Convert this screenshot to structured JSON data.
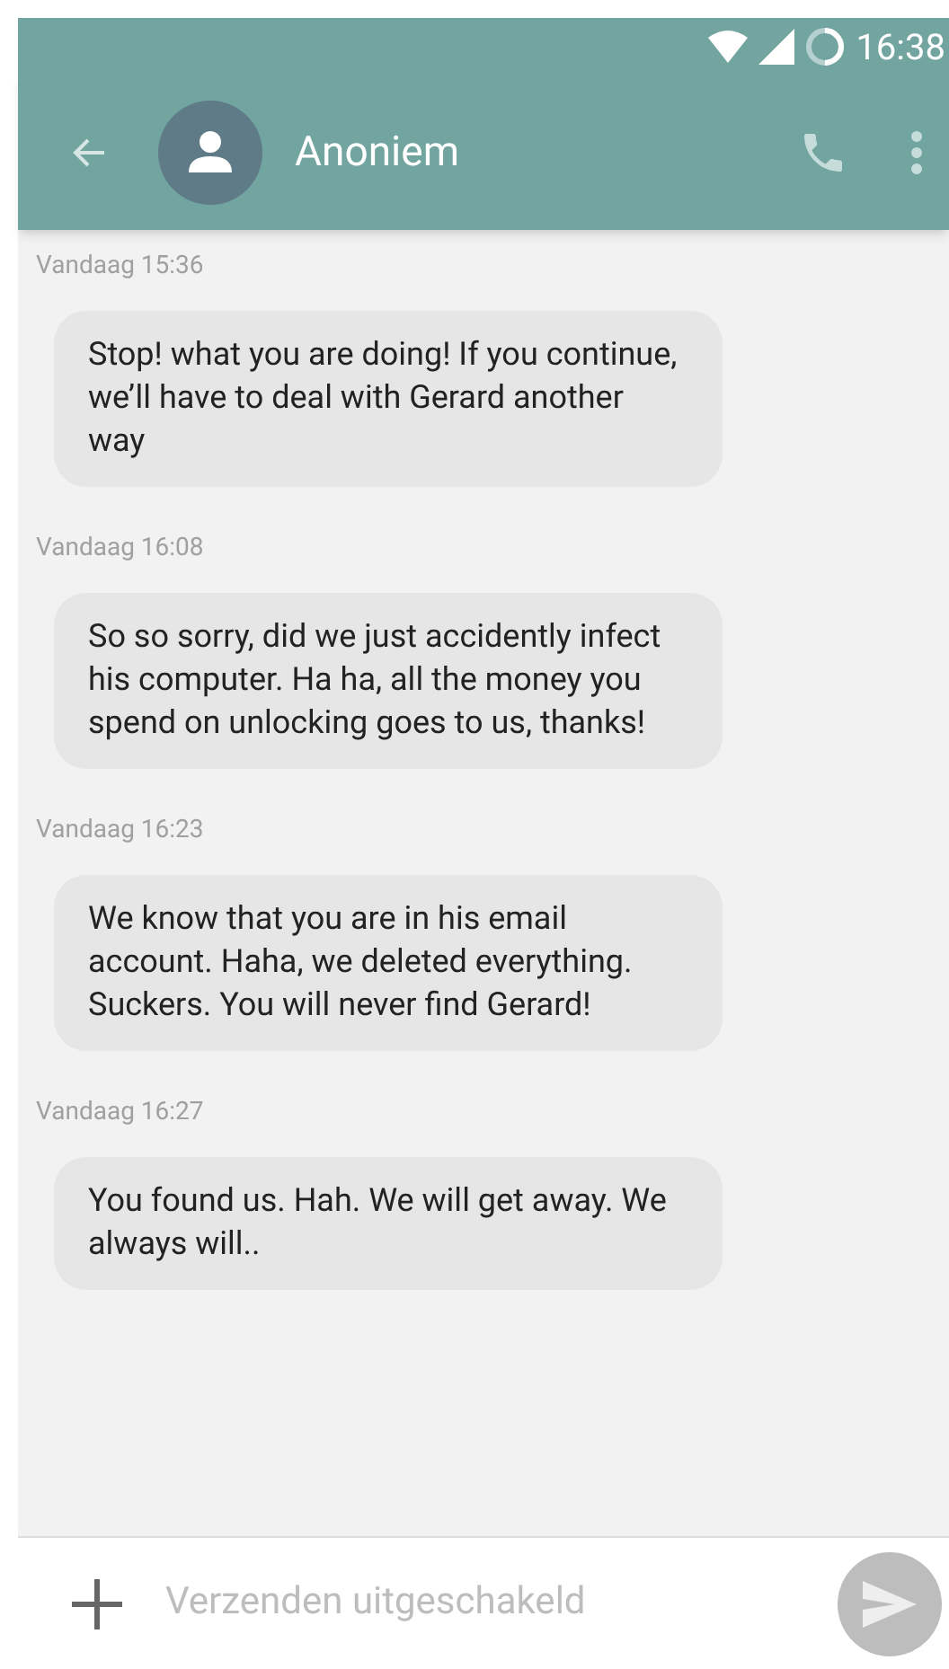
{
  "status_bar": {
    "time": "16:38"
  },
  "app_bar": {
    "title": "Anoniem"
  },
  "messages": [
    {
      "timestamp": "Vandaag 15:36",
      "text": "Stop! what you are doing! If you continue, we’ll have to deal with Gerard another way"
    },
    {
      "timestamp": "Vandaag 16:08",
      "text": "So so sorry, did we just accidently infect his computer. Ha ha, all the money you spend on unlocking goes to us, thanks!"
    },
    {
      "timestamp": "Vandaag 16:23",
      "text": "We know that you are in his email account. Haha, we deleted everything. Suckers. You will never find Gerard!"
    },
    {
      "timestamp": "Vandaag 16:27",
      "text": "You found us. Hah. We will get away. We always will.."
    }
  ],
  "composer": {
    "placeholder": "Verzenden uitgeschakeld",
    "disabled": true
  }
}
